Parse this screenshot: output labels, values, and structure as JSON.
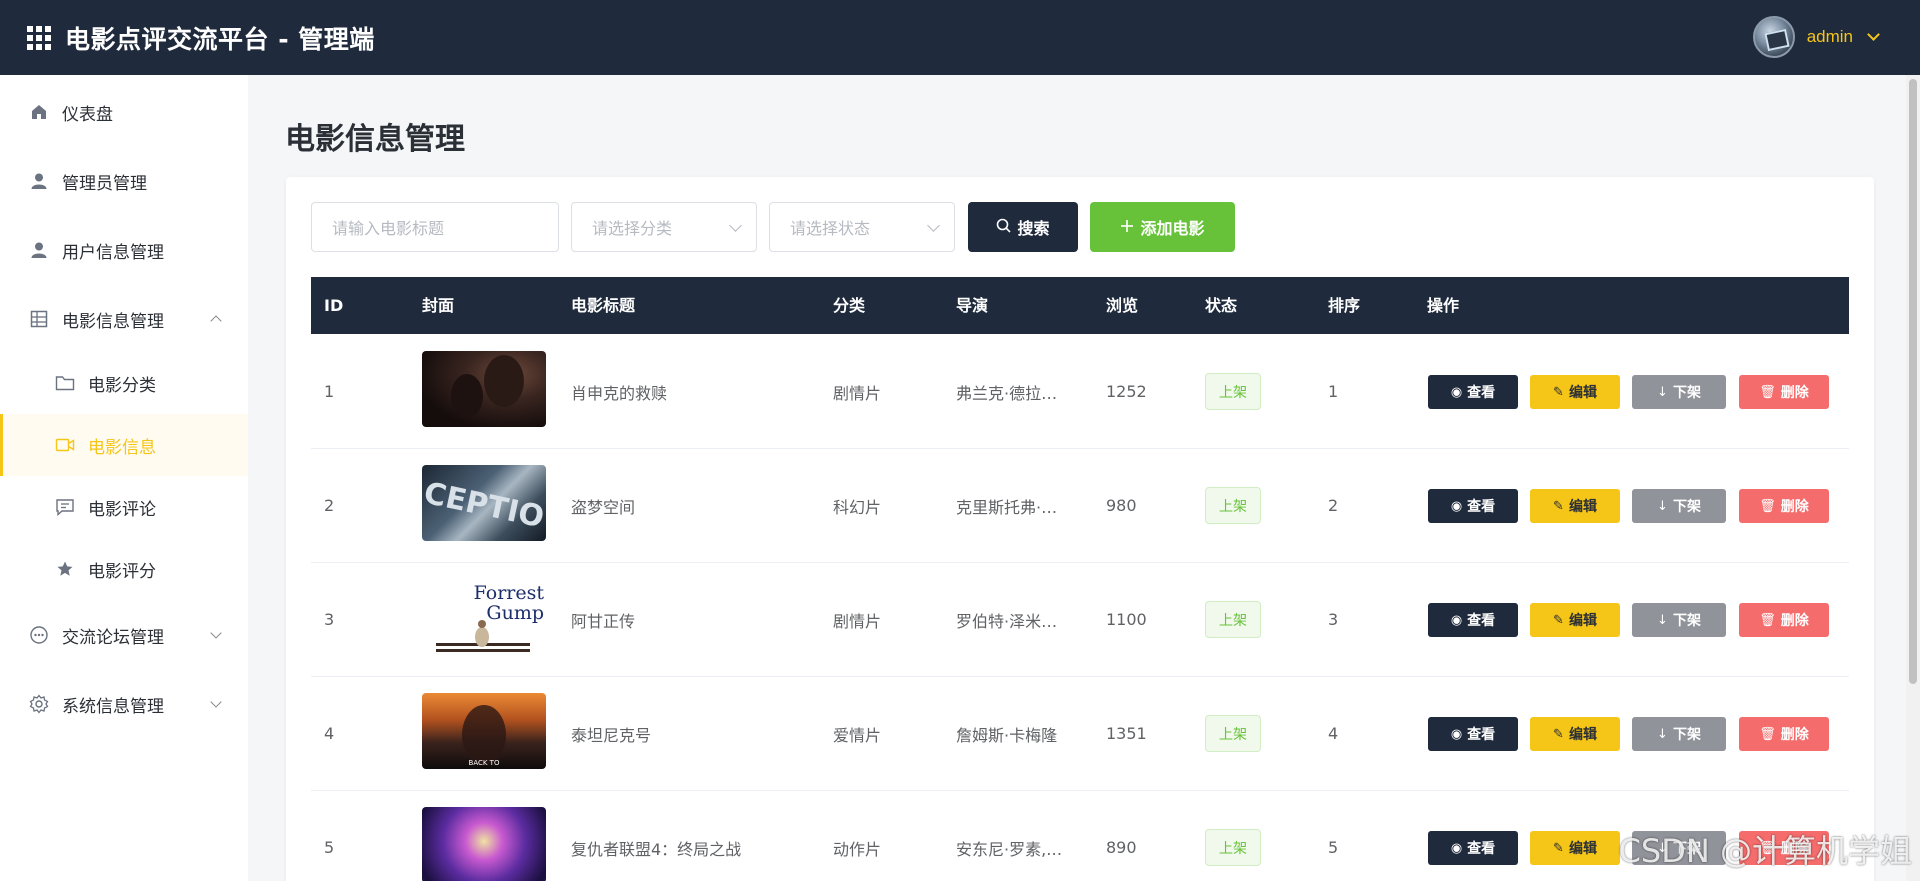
{
  "header": {
    "title": "电影点评交流平台 - 管理端",
    "username": "admin"
  },
  "sidebar": {
    "items": [
      {
        "label": "仪表盘",
        "icon": "home-icon"
      },
      {
        "label": "管理员管理",
        "icon": "user-icon"
      },
      {
        "label": "用户信息管理",
        "icon": "user-icon"
      },
      {
        "label": "电影信息管理",
        "icon": "grid-icon",
        "expanded": true
      },
      {
        "label": "电影分类",
        "icon": "folder-icon"
      },
      {
        "label": "电影信息",
        "icon": "video-icon",
        "active": true
      },
      {
        "label": "电影评论",
        "icon": "comment-icon"
      },
      {
        "label": "电影评分",
        "icon": "star-icon"
      },
      {
        "label": "交流论坛管理",
        "icon": "chat-icon"
      },
      {
        "label": "系统信息管理",
        "icon": "gear-icon"
      }
    ]
  },
  "page": {
    "title": "电影信息管理"
  },
  "toolbar": {
    "title_placeholder": "请输入电影标题",
    "category_placeholder": "请选择分类",
    "status_placeholder": "请选择状态",
    "search_label": "搜索",
    "add_label": "添加电影"
  },
  "table": {
    "columns": [
      "ID",
      "封面",
      "电影标题",
      "分类",
      "导演",
      "浏览",
      "状态",
      "排序",
      "操作"
    ],
    "rows": [
      {
        "id": "1",
        "title": "肖申克的救赎",
        "category": "剧情片",
        "director": "弗兰克·德拉…",
        "views": "1252",
        "status": "上架",
        "sort": "1"
      },
      {
        "id": "2",
        "title": "盗梦空间",
        "category": "科幻片",
        "director": "克里斯托弗·…",
        "views": "980",
        "status": "上架",
        "sort": "2"
      },
      {
        "id": "3",
        "title": "阿甘正传",
        "category": "剧情片",
        "director": "罗伯特·泽米…",
        "views": "1100",
        "status": "上架",
        "sort": "3"
      },
      {
        "id": "4",
        "title": "泰坦尼克号",
        "category": "爱情片",
        "director": "詹姆斯·卡梅隆",
        "views": "1351",
        "status": "上架",
        "sort": "4"
      },
      {
        "id": "5",
        "title": "复仇者联盟4：终局之战",
        "category": "动作片",
        "director": "安东尼·罗素,…",
        "views": "890",
        "status": "上架",
        "sort": "5"
      }
    ],
    "actions": {
      "view": "查看",
      "edit": "编辑",
      "offshelf": "下架",
      "delete": "删除"
    },
    "poster_text": {
      "p2": "CEPTIO",
      "p3_line1": "Forrest",
      "p3_line2": "Gump",
      "p4": "BACK TO"
    }
  },
  "watermark": "CSDN @计算机学姐"
}
